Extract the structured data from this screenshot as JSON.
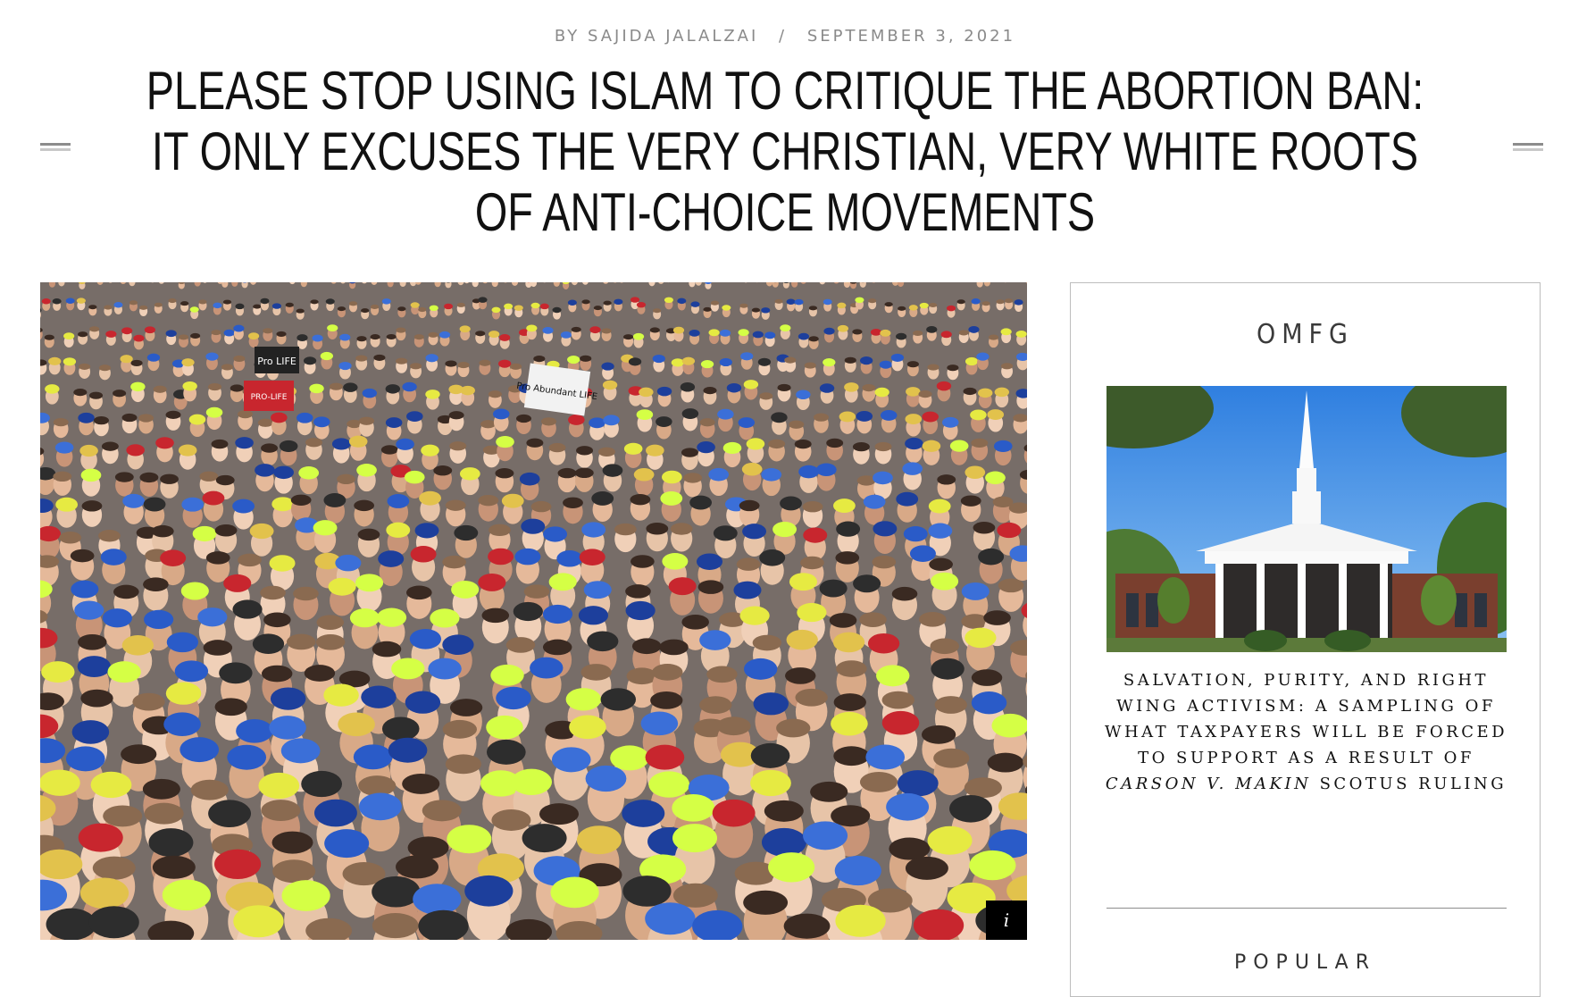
{
  "article": {
    "byline_author": "BY SAJIDA JALALZAI",
    "byline_separator": "/",
    "byline_date": "SEPTEMBER 3, 2021",
    "title": "PLEASE STOP USING ISLAM TO CRITIQUE THE ABORTION BAN: IT ONLY EXCUSES THE VERY CHRISTIAN, VERY WHITE ROOTS OF ANTI-CHOICE MOVEMENTS",
    "hero_signs": [
      "Pro LIFE",
      "Pro Abundant LIFE",
      "PRO-LIFE"
    ],
    "info_button": "i"
  },
  "sidebar": {
    "heading": "OMFG",
    "card": {
      "title_before": "SALVATION, PURITY, AND RIGHT WING ACTIVISM: A SAMPLING OF WHAT TAXPAYERS WILL BE FORCED TO SUPPORT AS A RESULT OF ",
      "title_italic": "CARSON V. MAKIN",
      "title_after": " SCOTUS RULING"
    },
    "next_heading": "POPULAR"
  },
  "colors": {
    "byline": "#8a8a8a",
    "text": "#111111",
    "sky": "#3f8be0",
    "brick": "#7a3f2e"
  }
}
